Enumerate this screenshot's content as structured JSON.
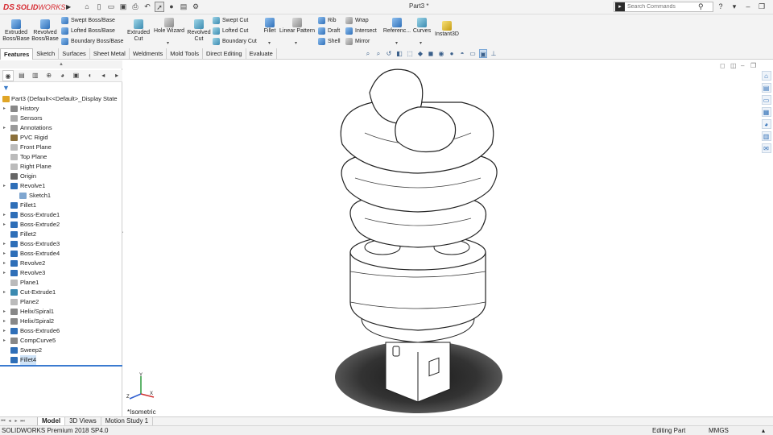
{
  "app": {
    "logo_ds": "DS",
    "logo_solid": "SOLID",
    "logo_works": "WORKS",
    "document_title": "Part3 *",
    "search_placeholder": "Search Commands",
    "window_controls": [
      "?",
      "▾",
      "–",
      "❐",
      "✕"
    ]
  },
  "ribbon": {
    "extruded_boss": "Extruded Boss/Base",
    "revolved_boss": "Revolved Boss/Base",
    "swept_boss": "Swept Boss/Base",
    "lofted_boss": "Lofted Boss/Base",
    "boundary_boss": "Boundary Boss/Base",
    "extruded_cut": "Extruded Cut",
    "hole_wizard": "Hole Wizard",
    "revolved_cut": "Revolved Cut",
    "swept_cut": "Swept Cut",
    "lofted_cut": "Lofted Cut",
    "boundary_cut": "Boundary Cut",
    "fillet": "Fillet",
    "linear_pattern": "Linear Pattern",
    "rib": "Rib",
    "draft": "Draft",
    "shell": "Shell",
    "wrap": "Wrap",
    "intersect": "Intersect",
    "mirror": "Mirror",
    "reference": "Referenc...",
    "curves": "Curves",
    "instant3d": "Instant3D"
  },
  "tabs": [
    "Features",
    "Sketch",
    "Surfaces",
    "Sheet Metal",
    "Weldments",
    "Mold Tools",
    "Direct Editing",
    "Evaluate"
  ],
  "tree": {
    "root": "Part3  (Default<<Default>_Display State ",
    "items": [
      "History",
      "Sensors",
      "Annotations",
      "PVC Rigid",
      "Front Plane",
      "Top Plane",
      "Right Plane",
      "Origin",
      "Revolve1",
      "Sketch1",
      "Fillet1",
      "Boss-Extrude1",
      "Boss-Extrude2",
      "Fillet2",
      "Boss-Extrude3",
      "Boss-Extrude4",
      "Revolve2",
      "Revolve3",
      "Plane1",
      "Cut-Extrude1",
      "Plane2",
      "Helix/Spiral1",
      "Helix/Spiral2",
      "Boss-Extrude6",
      "CompCurve5",
      "Sweep2",
      "Fillet4"
    ]
  },
  "viewport": {
    "view_label": "*Isometric",
    "triad_x": "X",
    "triad_y": "Y",
    "triad_z": "Z"
  },
  "bottom_tabs": [
    "Model",
    "3D Views",
    "Motion Study 1"
  ],
  "status": {
    "product": "SOLIDWORKS Premium 2018 SP4.0",
    "mode": "Editing Part",
    "units": "MMGS",
    "arrow": "▴"
  }
}
